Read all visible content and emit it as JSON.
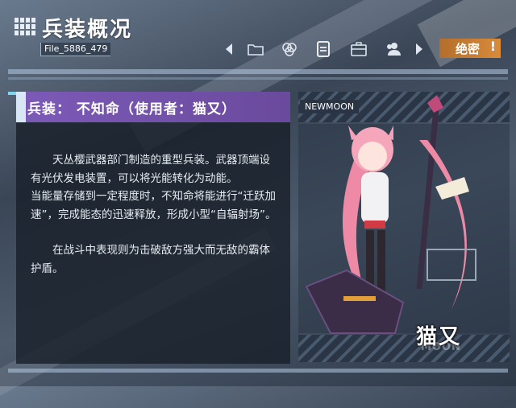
{
  "header": {
    "title": "兵装概况",
    "file_id": "File_5886_479",
    "classification": "绝密",
    "classification_mark": "!"
  },
  "toolbar": {
    "icons": [
      "prev-arrow-icon",
      "folder-icon",
      "hex-ring-icon",
      "document-icon",
      "briefcase-icon",
      "users-icon",
      "next-arrow-icon"
    ],
    "active": "document-icon"
  },
  "panel": {
    "heading": "兵装：  不知命（使用者：猫又）",
    "paragraphs": [
      "天丛樱武器部门制造的重型兵装。武器顶端设有光伏发电装置，可以将光能转化为动能。",
      "当能量存储到一定程度时，不知命将能进行“迁跃加速”，完成能态的迅速释放，形成小型“自辐射场”。",
      "在战斗中表现则为击破敌方强大而无敌的霸体护盾。"
    ]
  },
  "art": {
    "tag": "NEWMOON",
    "character_name": "猫又",
    "watermark": "MOON"
  },
  "colors": {
    "heading_bg": "#7c5ab8",
    "secret_bg": "#d98b3a",
    "accent": "#7fd4ef"
  }
}
